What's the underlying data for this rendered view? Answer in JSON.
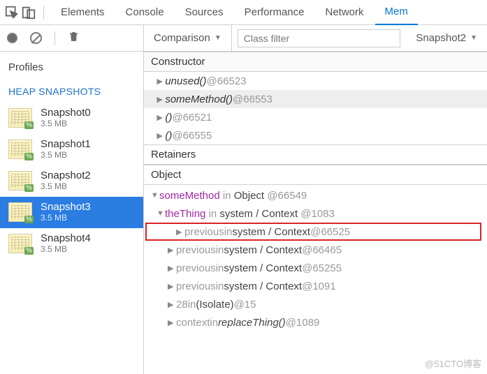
{
  "tabs": {
    "elements": "Elements",
    "console": "Console",
    "sources": "Sources",
    "performance": "Performance",
    "network": "Network",
    "memory": "Mem"
  },
  "filter": {
    "mode": "Comparison",
    "placeholder": "Class filter",
    "compare": "Snapshot2"
  },
  "left": {
    "profiles": "Profiles",
    "heap": "HEAP SNAPSHOTS",
    "snapshots": [
      {
        "name": "Snapshot0",
        "size": "3.5 MB"
      },
      {
        "name": "Snapshot1",
        "size": "3.5 MB"
      },
      {
        "name": "Snapshot2",
        "size": "3.5 MB"
      },
      {
        "name": "Snapshot3",
        "size": "3.5 MB"
      },
      {
        "name": "Snapshot4",
        "size": "3.5 MB"
      }
    ]
  },
  "constructor_header": "Constructor",
  "constructors": [
    {
      "label": "unused()",
      "id": "@66523"
    },
    {
      "label": "someMethod()",
      "id": "@66553",
      "selected": true
    },
    {
      "label": "()",
      "id": "@66521"
    },
    {
      "label": "()",
      "id": "@66555"
    }
  ],
  "retainers_header": "Retainers",
  "object_header": "Object",
  "retainers": {
    "root": {
      "name": "someMethod",
      "in": "in",
      "ctx": "Object",
      "id": "@66549"
    },
    "thing": {
      "name": "theThing",
      "in": "in",
      "ctx": "system / Context",
      "id": "@1083"
    },
    "refs": [
      {
        "name": "previous",
        "ctx": "system / Context",
        "id": "@66525",
        "boxed": true
      },
      {
        "name": "previous",
        "ctx": "system / Context",
        "id": "@66465"
      },
      {
        "name": "previous",
        "ctx": "system / Context",
        "id": "@65255"
      },
      {
        "name": "previous",
        "ctx": "system / Context",
        "id": "@1091"
      },
      {
        "name": "28",
        "ctx": "(Isolate)",
        "id": "@15"
      },
      {
        "name": "context",
        "ctx": "replaceThing()",
        "id": "@1089",
        "italicctx": true
      }
    ],
    "in": "in"
  },
  "watermark": "@51CTO博客"
}
